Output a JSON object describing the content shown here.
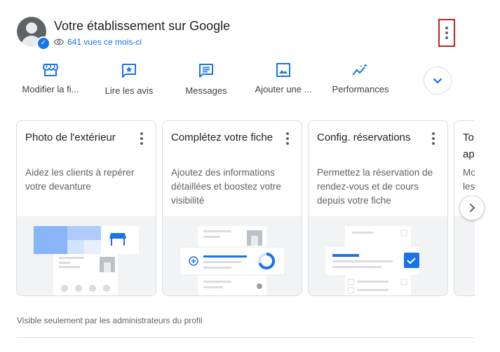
{
  "header": {
    "title": "Votre établissement sur Google",
    "views": "641 vues ce mois-ci"
  },
  "actions": [
    {
      "label": "Modifier la fi...",
      "icon": "storefront-icon"
    },
    {
      "label": "Lire les avis",
      "icon": "review-star-icon"
    },
    {
      "label": "Messages",
      "icon": "message-icon"
    },
    {
      "label": "Ajouter une ...",
      "icon": "photo-icon"
    },
    {
      "label": "Performances",
      "icon": "performance-sparkle-icon"
    }
  ],
  "cards": [
    {
      "title": "Photo de l'extérieur",
      "desc": "Aidez les clients à repérer votre devanture"
    },
    {
      "title": "Complétez votre fiche",
      "desc": "Ajoutez des informations détaillées et boostez votre visibilité"
    },
    {
      "title": "Config. réservations",
      "desc": "Permettez la réservation de rendez-vous et de cours depuis votre fiche"
    },
    {
      "title": "To ap",
      "desc": "Mo les"
    }
  ],
  "footer": {
    "note": "Visible seulement par les administrateurs du profil"
  },
  "colors": {
    "accent": "#1a73e8",
    "text": "#202124",
    "secondary": "#5f6368",
    "border": "#dadce0",
    "highlight_border": "#c5221f"
  }
}
